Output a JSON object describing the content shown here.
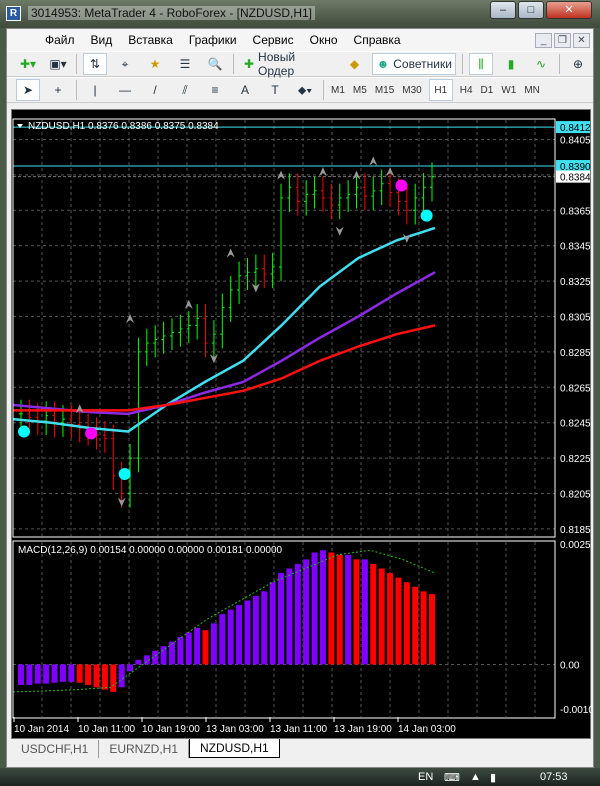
{
  "window": {
    "title": "3014953: MetaTrader 4 - RoboForex - [NZDUSD,H1]",
    "minimize": "‒",
    "maximize": "□",
    "close": "✕"
  },
  "menu": [
    "Файл",
    "Вид",
    "Вставка",
    "Графики",
    "Сервис",
    "Окно",
    "Справка"
  ],
  "toolbar1": {
    "new_order": "Новый Ордер",
    "experts": "Советники"
  },
  "timeframes": [
    "M1",
    "M5",
    "M15",
    "M30",
    "H1",
    "H4",
    "D1",
    "W1",
    "MN"
  ],
  "active_timeframe": "H1",
  "tabs": [
    "USDCHF,H1",
    "EURNZD,H1",
    "NZDUSD,H1"
  ],
  "active_tab": "NZDUSD,H1",
  "taskbar": {
    "lang": "EN",
    "time": "07:53"
  },
  "colors": {
    "bull": "#00ff00",
    "bear": "#ff0000",
    "ma_fast": "#40e0f0",
    "ma_mid": "#8a2be2",
    "ma_slow": "#ff1010",
    "hist_up": "#7f00ff",
    "hist_down": "#ff0000",
    "signal": "#22bb22",
    "hline": "#40e0f0"
  },
  "chart_data": {
    "type": "line",
    "title": "NZDUSD,H1 0.8376 0.8386 0.8375 0.8384",
    "ylim": [
      0.8181,
      0.8416
    ],
    "yticks": [
      "0.8405",
      "0.8385",
      "0.8365",
      "0.8345",
      "0.8325",
      "0.8305",
      "0.8285",
      "0.8265",
      "0.8245",
      "0.8225",
      "0.8205",
      "0.8185"
    ],
    "hlines": [
      "0.8412",
      "0.8390"
    ],
    "current_price": "0.8384",
    "xticks": [
      "10 Jan 2014",
      "10 Jan 11:00",
      "10 Jan 19:00",
      "13 Jan 03:00",
      "13 Jan 11:00",
      "13 Jan 19:00",
      "14 Jan 03:00"
    ],
    "closes": [
      0.825,
      0.8248,
      0.8246,
      0.8249,
      0.8245,
      0.8247,
      0.8244,
      0.8242,
      0.824,
      0.8238,
      0.8236,
      0.8215,
      0.8205,
      0.8225,
      0.8285,
      0.829,
      0.8292,
      0.8294,
      0.8296,
      0.8298,
      0.83,
      0.8304,
      0.829,
      0.8295,
      0.831,
      0.832,
      0.8328,
      0.833,
      0.8332,
      0.8329,
      0.8333,
      0.8372,
      0.8378,
      0.837,
      0.8374,
      0.8376,
      0.8372,
      0.8368,
      0.8372,
      0.8374,
      0.8378,
      0.8373,
      0.8376,
      0.838,
      0.8375,
      0.837,
      0.8365,
      0.8372,
      0.8378,
      0.8384
    ],
    "ma_fast": [
      0.8247,
      0.8245,
      0.8242,
      0.824,
      0.8255,
      0.8268,
      0.828,
      0.83,
      0.8322,
      0.8338,
      0.8348,
      0.8355
    ],
    "ma_mid": [
      0.8255,
      0.8253,
      0.8251,
      0.825,
      0.8255,
      0.8262,
      0.8268,
      0.828,
      0.8293,
      0.8305,
      0.8318,
      0.833
    ],
    "ma_slow": [
      0.8252,
      0.8252,
      0.8252,
      0.8252,
      0.8255,
      0.8259,
      0.8263,
      0.827,
      0.828,
      0.8288,
      0.8295,
      0.83
    ],
    "dots_fast": [
      [
        0,
        0.824
      ],
      [
        12,
        0.8216
      ],
      [
        48,
        0.8362
      ]
    ],
    "dots_mid": [
      [
        8,
        0.8239
      ],
      [
        45,
        0.8379
      ]
    ],
    "fractals_up": [
      [
        7,
        0.8252
      ],
      [
        13,
        0.8303
      ],
      [
        20,
        0.8311
      ],
      [
        25,
        0.834
      ],
      [
        31,
        0.8384
      ],
      [
        36,
        0.8386
      ],
      [
        40,
        0.8384
      ],
      [
        42,
        0.8392
      ],
      [
        44,
        0.8386
      ]
    ],
    "fractals_down": [
      [
        12,
        0.8201
      ],
      [
        23,
        0.8282
      ],
      [
        28,
        0.8322
      ],
      [
        38,
        0.8354
      ],
      [
        46,
        0.835
      ]
    ],
    "macd": {
      "label": "MACD(12,26,9) 0.00154 0.00000 0.00000 0.00181 0.00000",
      "ylim": [
        -0.00115,
        0.00268
      ],
      "yticks": [
        "0.00256",
        "0.00",
        "-0.00104"
      ],
      "hist": [
        -0.00045,
        -0.00045,
        -0.00042,
        -0.00042,
        -0.0004,
        -0.00038,
        -0.00038,
        -0.0004,
        -0.00045,
        -0.0005,
        -0.00055,
        -0.0006,
        -0.0005,
        -0.00015,
        0.0001,
        0.0002,
        0.0003,
        0.0004,
        0.0005,
        0.0006,
        0.0007,
        0.0008,
        0.00075,
        0.0009,
        0.0011,
        0.0012,
        0.0013,
        0.0014,
        0.0015,
        0.0016,
        0.0018,
        0.002,
        0.0021,
        0.0022,
        0.0023,
        0.00245,
        0.0025,
        0.00245,
        0.0024,
        0.0024,
        0.0023,
        0.0023,
        0.0022,
        0.0021,
        0.002,
        0.0019,
        0.0018,
        0.0017,
        0.0016,
        0.00154
      ],
      "signal": [
        -0.0006,
        -0.00058,
        -0.00055,
        -0.0005,
        0.0,
        0.0005,
        0.001,
        0.0014,
        0.0018,
        0.0021,
        0.0024,
        0.0025,
        0.0023,
        0.002
      ]
    }
  }
}
